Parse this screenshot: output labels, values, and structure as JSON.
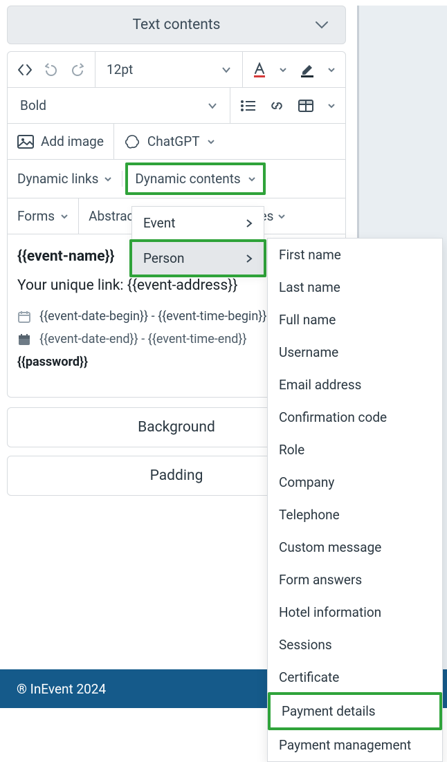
{
  "header": {
    "title": "Text contents"
  },
  "toolbar": {
    "font_size": "12pt",
    "font_weight": "Bold",
    "add_image_label": "Add image",
    "chatgpt_label": "ChatGPT",
    "dynamic_links_label": "Dynamic links",
    "dynamic_contents_label": "Dynamic contents",
    "forms_label": "Forms",
    "abstracts_label": "Abstracts",
    "trailing_label_fragment": "es"
  },
  "first_menu": {
    "items": [
      "Event",
      "Person"
    ],
    "selected": "Person"
  },
  "second_menu": {
    "items": [
      "First name",
      "Last name",
      "Full name",
      "Username",
      "Email address",
      "Confirmation code",
      "Role",
      "Company",
      "Telephone",
      "Custom message",
      "Form answers",
      "Hotel information",
      "Sessions",
      "Certificate",
      "Payment details",
      "Payment management"
    ],
    "highlighted": "Payment details"
  },
  "content": {
    "event_name": "{{event-name}}",
    "unique_prefix": "Your unique link: ",
    "unique_value": "{{event-address}}",
    "begin_line": "{{event-date-begin}} - {{event-time-begin}}",
    "end_line": "{{event-date-end}} - {{event-time-end}}",
    "password": "{{password}}"
  },
  "panels": {
    "background": "Background",
    "padding": "Padding"
  },
  "footer": {
    "text": "® InEvent 2024"
  }
}
